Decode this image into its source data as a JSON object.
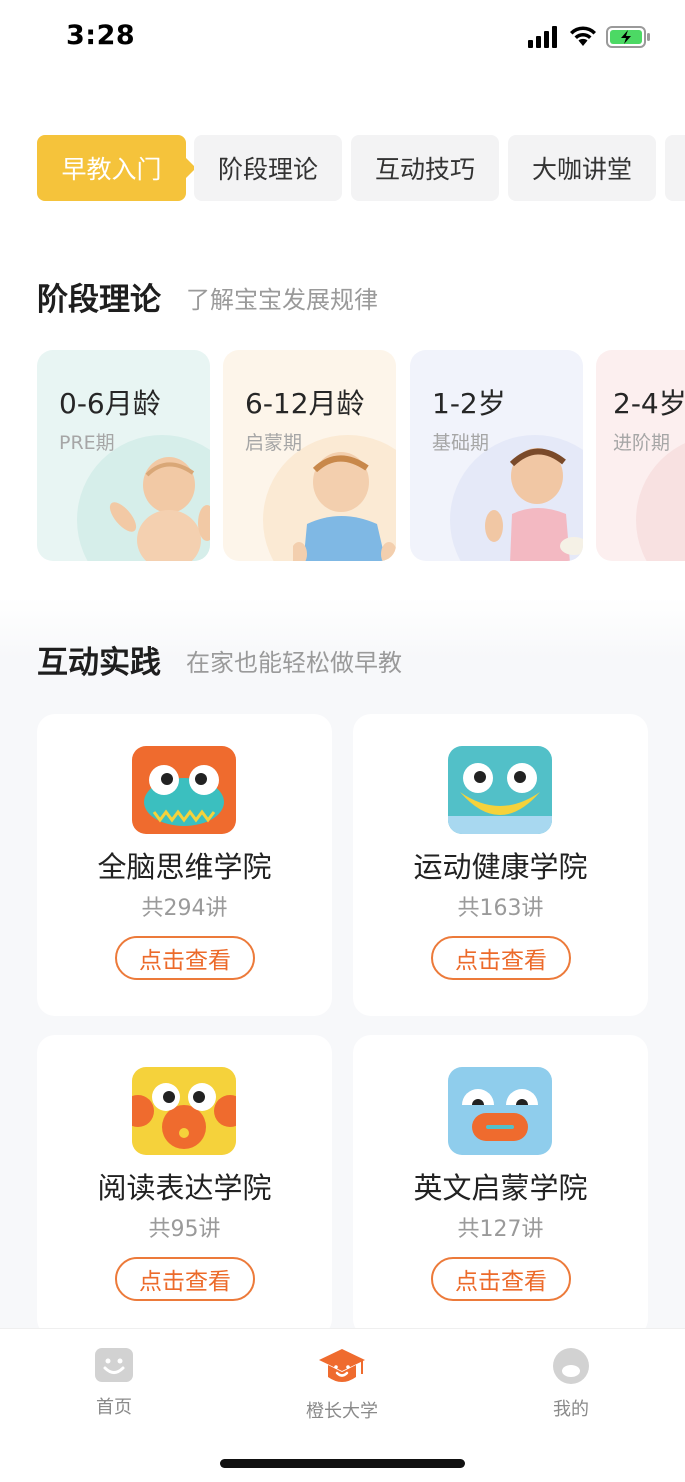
{
  "status_bar": {
    "time": "3:28"
  },
  "tabs": [
    {
      "label": "早教入门",
      "active": true
    },
    {
      "label": "阶段理论",
      "active": false
    },
    {
      "label": "互动技巧",
      "active": false
    },
    {
      "label": "大咖讲堂",
      "active": false
    }
  ],
  "stage_section": {
    "title": "阶段理论",
    "subtitle": "了解宝宝发展规律"
  },
  "stages": [
    {
      "age": "0-6月龄",
      "phase": "PRE期",
      "bg": "#e8f5f3"
    },
    {
      "age": "6-12月龄",
      "phase": "启蒙期",
      "bg": "#fdf5ea"
    },
    {
      "age": "1-2岁",
      "phase": "基础期",
      "bg": "#f1f3fb"
    },
    {
      "age": "2-4岁",
      "phase": "进阶期",
      "bg": "#fcefef"
    }
  ],
  "practice_section": {
    "title": "互动实践",
    "subtitle": "在家也能轻松做早教"
  },
  "colleges": [
    {
      "name": "全脑思维学院",
      "count": "共294讲",
      "button": "点击查看"
    },
    {
      "name": "运动健康学院",
      "count": "共163讲",
      "button": "点击查看"
    },
    {
      "name": "阅读表达学院",
      "count": "共95讲",
      "button": "点击查看"
    },
    {
      "name": "英文启蒙学院",
      "count": "共127讲",
      "button": "点击查看"
    }
  ],
  "bottom_nav": [
    {
      "label": "首页",
      "icon": "smile-face-icon",
      "active": false
    },
    {
      "label": "橙长大学",
      "icon": "graduation-cap-icon",
      "active": true
    },
    {
      "label": "我的",
      "icon": "profile-icon",
      "active": false
    }
  ],
  "colors": {
    "accent_yellow": "#f5c33b",
    "accent_orange": "#ec6a2a"
  }
}
